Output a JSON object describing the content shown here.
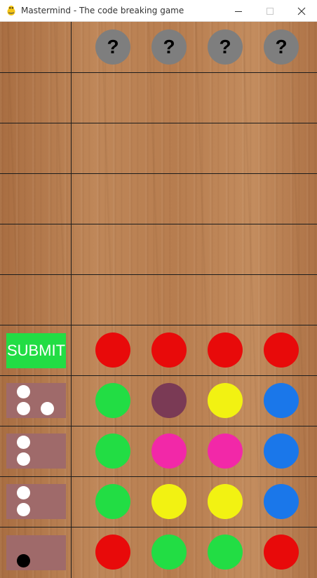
{
  "window": {
    "title": "Mastermind - The code breaking game",
    "icon": "pygame-snake-icon",
    "controls": [
      "minimize-icon",
      "maximize-icon",
      "close-icon"
    ]
  },
  "colors": {
    "red": "#e80a0a",
    "green": "#22dd44",
    "purple": "#7a3a55",
    "yellow": "#f2f212",
    "blue": "#1a77ea",
    "pink": "#f228a8",
    "secret_hidden": "#7e7e7e",
    "feedback_box": "#9f6a6a",
    "submit_bg": "#22dd44"
  },
  "secret_code": {
    "symbols": [
      "?",
      "?",
      "?",
      "?"
    ]
  },
  "submit_label": "SUBMIT",
  "current_guess": [
    "red",
    "red",
    "red",
    "red"
  ],
  "history": [
    {
      "guess": [
        "green",
        "purple",
        "yellow",
        "blue"
      ],
      "feedback": [
        "white",
        "white",
        "white"
      ]
    },
    {
      "guess": [
        "green",
        "pink",
        "pink",
        "blue"
      ],
      "feedback": [
        "white",
        "white"
      ]
    },
    {
      "guess": [
        "green",
        "yellow",
        "yellow",
        "blue"
      ],
      "feedback": [
        "white",
        "white"
      ]
    },
    {
      "guess": [
        "red",
        "green",
        "green",
        "red"
      ],
      "feedback": [
        "black"
      ]
    }
  ]
}
